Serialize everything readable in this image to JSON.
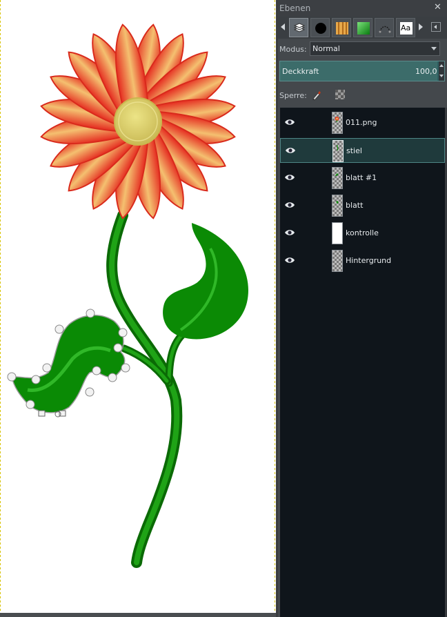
{
  "dialog": {
    "title": "Ebenen",
    "close_glyph": "✕"
  },
  "tabs": [
    {
      "name": "layers-tab",
      "icon": "layers-icon",
      "active": true
    },
    {
      "name": "brushes-tab",
      "icon": "brush-icon"
    },
    {
      "name": "patterns-tab",
      "icon": "pattern-icon"
    },
    {
      "name": "gradients-tab",
      "icon": "gradient-icon"
    },
    {
      "name": "paths-tab",
      "icon": "paths-icon"
    },
    {
      "name": "fonts-tab",
      "icon": "font-icon",
      "text": "Aa"
    }
  ],
  "mode": {
    "label": "Modus:",
    "value": "Normal"
  },
  "opacity": {
    "label": "Deckkraft",
    "value": "100,0",
    "fraction": 1.0
  },
  "lock": {
    "label": "Sperre:"
  },
  "layers": [
    {
      "name": "011.png",
      "thumb": "flower",
      "selected": false
    },
    {
      "name": "stiel",
      "thumb": "stem",
      "selected": true
    },
    {
      "name": "blatt #1",
      "thumb": "leaf",
      "selected": false
    },
    {
      "name": "blatt",
      "thumb": "leaf",
      "selected": false
    },
    {
      "name": "kontrolle",
      "thumb": "white",
      "selected": false
    },
    {
      "name": "Hintergrund",
      "thumb": "checker",
      "selected": false
    }
  ],
  "colors": {
    "petal_outer": "#e52b20",
    "petal_inner": "#f4c070",
    "center": "#dfd26a",
    "stem": "#0d8a05",
    "leaf": "#0a8a05",
    "selection_handle": "#f2f2f2"
  }
}
